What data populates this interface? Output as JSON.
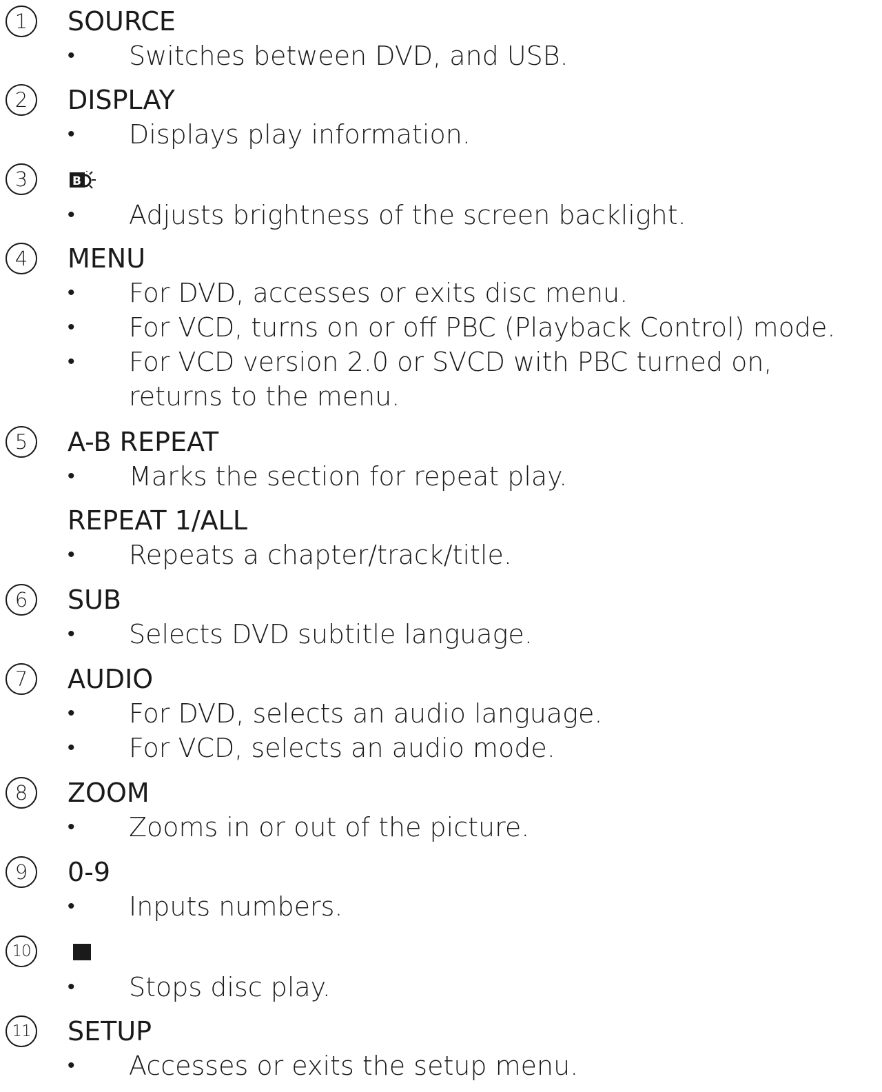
{
  "items": [
    {
      "num": "1",
      "title": "SOURCE",
      "bullets": [
        "Switches between DVD, and USB."
      ]
    },
    {
      "num": "2",
      "title": "DISPLAY",
      "bullets": [
        "Displays play information."
      ]
    },
    {
      "num": "3",
      "icon": "backlight-brightness-icon",
      "bullets": [
        "Adjusts brightness of the screen backlight."
      ]
    },
    {
      "num": "4",
      "title": "MENU",
      "bullets": [
        "For DVD, accesses or exits disc menu.",
        "For VCD, turns on or off PBC (Playback Control) mode.",
        "For VCD version 2.0 or SVCD with PBC turned on, returns to the menu."
      ]
    },
    {
      "num": "5",
      "title": "A-B REPEAT",
      "bullets": [
        "Marks the section for repeat play."
      ],
      "subtitle": "REPEAT 1/ALL",
      "sub_bullets": [
        "Repeats a chapter/track/title."
      ]
    },
    {
      "num": "6",
      "title": "SUB",
      "bullets": [
        "Selects DVD subtitle language."
      ]
    },
    {
      "num": "7",
      "title": "AUDIO",
      "bullets": [
        "For DVD, selects an audio language.",
        "For VCD, selects an audio mode."
      ]
    },
    {
      "num": "8",
      "title": "ZOOM",
      "bullets": [
        "Zooms in or out of the picture."
      ]
    },
    {
      "num": "9",
      "title": "0-9",
      "bullets": [
        "Inputs numbers."
      ]
    },
    {
      "num": "10",
      "icon": "stop-icon",
      "bullets": [
        "Stops disc play."
      ]
    },
    {
      "num": "11",
      "title": "SETUP",
      "bullets": [
        "Accesses or exits the setup menu."
      ]
    }
  ],
  "bullet_char": "•",
  "icon_bl_letter": "B"
}
